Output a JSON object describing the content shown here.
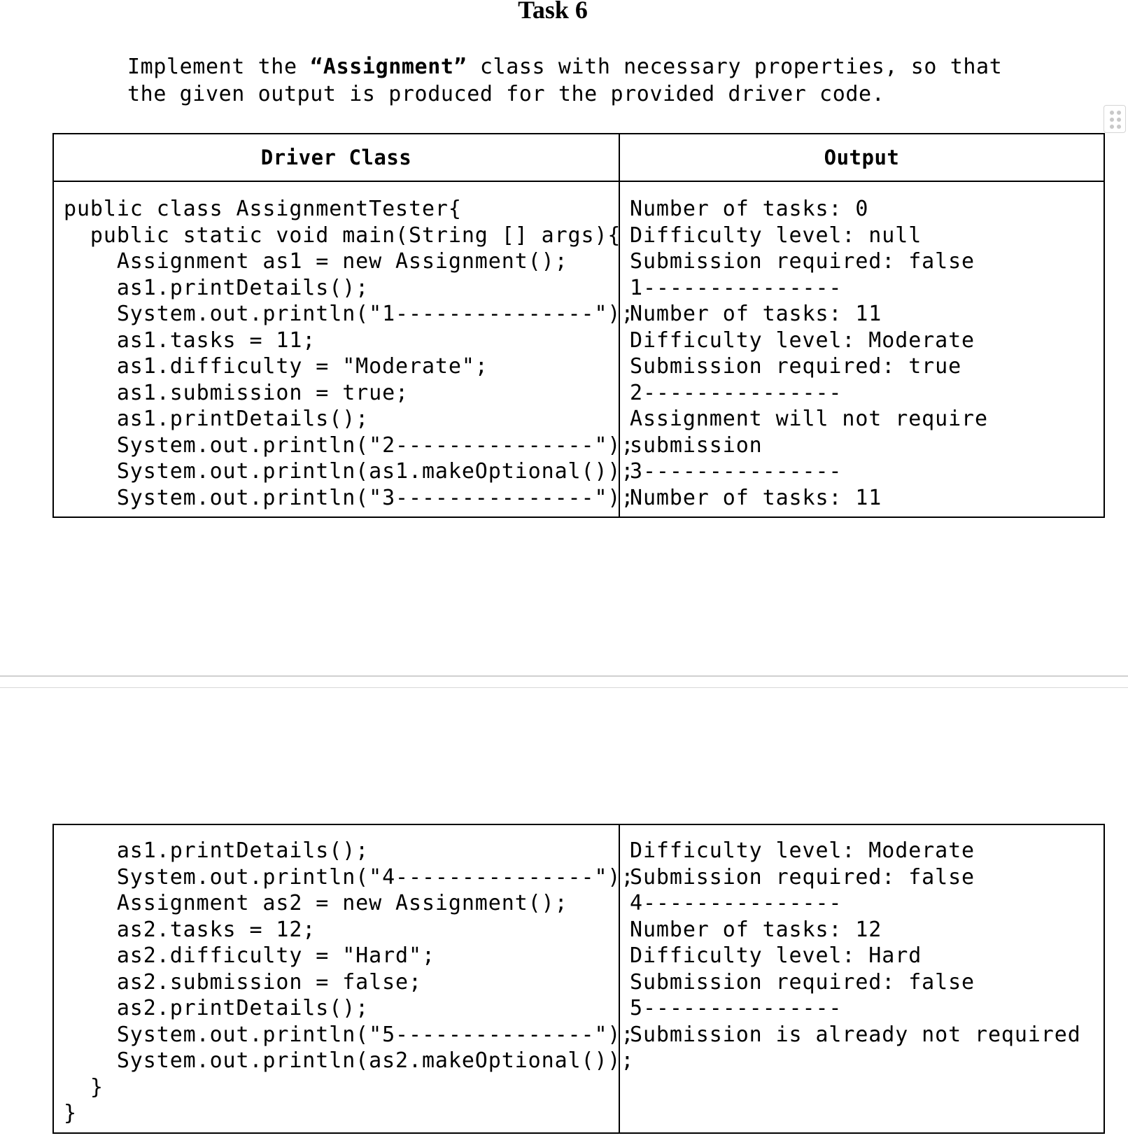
{
  "title": "Task 6",
  "intro": {
    "part1": "Implement the ",
    "class_name": "“Assignment”",
    "part2": " class with necessary properties, so that",
    "line2": "the given output is produced for the provided driver code."
  },
  "table_headers": {
    "driver": "Driver Class",
    "output": "Output"
  },
  "driver_code_part1": [
    "public class AssignmentTester{",
    "  public static void main(String [] args){",
    "    Assignment as1 = new Assignment();",
    "    as1.printDetails();",
    "    System.out.println(\"1---------------\");",
    "    as1.tasks = 11;",
    "    as1.difficulty = \"Moderate\";",
    "    as1.submission = true;",
    "    as1.printDetails();",
    "    System.out.println(\"2---------------\");",
    "    System.out.println(as1.makeOptional());",
    "    System.out.println(\"3---------------\");"
  ],
  "output_part1": [
    "Number of tasks: 0",
    "Difficulty level: null",
    "Submission required: false",
    "1---------------",
    "Number of tasks: 11",
    "Difficulty level: Moderate",
    "Submission required: true",
    "2---------------",
    "Assignment will not require",
    "submission",
    "3---------------",
    "Number of tasks: 11"
  ],
  "driver_code_part2": [
    "    as1.printDetails();",
    "    System.out.println(\"4---------------\");",
    "    Assignment as2 = new Assignment();",
    "    as2.tasks = 12;",
    "    as2.difficulty = \"Hard\";",
    "    as2.submission = false;",
    "    as2.printDetails();",
    "    System.out.println(\"5---------------\");",
    "    System.out.println(as2.makeOptional());",
    "  }",
    "}"
  ],
  "output_part2": [
    "Difficulty level: Moderate",
    "Submission required: false",
    "4---------------",
    "Number of tasks: 12",
    "Difficulty level: Hard",
    "Submission required: false",
    "5---------------",
    "Submission is already not required"
  ]
}
